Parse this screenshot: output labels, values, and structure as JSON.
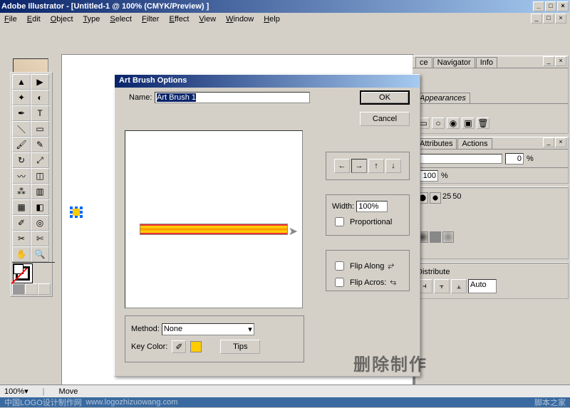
{
  "titlebar": {
    "app": "Adobe Illustrator",
    "doc": "[Untitled-1 @ 100% (CMYK/Preview) ]"
  },
  "menus": [
    "File",
    "Edit",
    "Object",
    "Type",
    "Select",
    "Filter",
    "Effect",
    "View",
    "Window",
    "Help"
  ],
  "winbtns": {
    "min": "_",
    "max": "□",
    "close": "×"
  },
  "panels": {
    "nav": [
      "ce",
      "Navigator",
      "Info"
    ],
    "app": [
      "Appearances"
    ],
    "attr": [
      "Attributes",
      "Actions"
    ],
    "attr_val": "0",
    "pct": [
      "100",
      "%"
    ],
    "brush_sizes": [
      "25",
      "50"
    ],
    "distribute": [
      "Distribute"
    ],
    "auto": "Auto"
  },
  "statusbar": {
    "zoom": "100%",
    "tool": "Move"
  },
  "wm": {
    "left": "中国LOGO设计制作网",
    "url": "www.logozhizuowang.com",
    "right": "脚本之家"
  },
  "dialog": {
    "title": "Art Brush Options",
    "name_label": "Name:",
    "name_value": "Art Brush 1",
    "ok": "OK",
    "cancel": "Cancel",
    "width_label": "Width:",
    "width_value": "100%",
    "proportional": "Proportional",
    "flip_along": "Flip Along",
    "flip_across": "Flip Acros:",
    "method_label": "Method:",
    "method_value": "None",
    "keycolor_label": "Key Color:",
    "tips": "Tips"
  },
  "cn_wm": "删除制作"
}
